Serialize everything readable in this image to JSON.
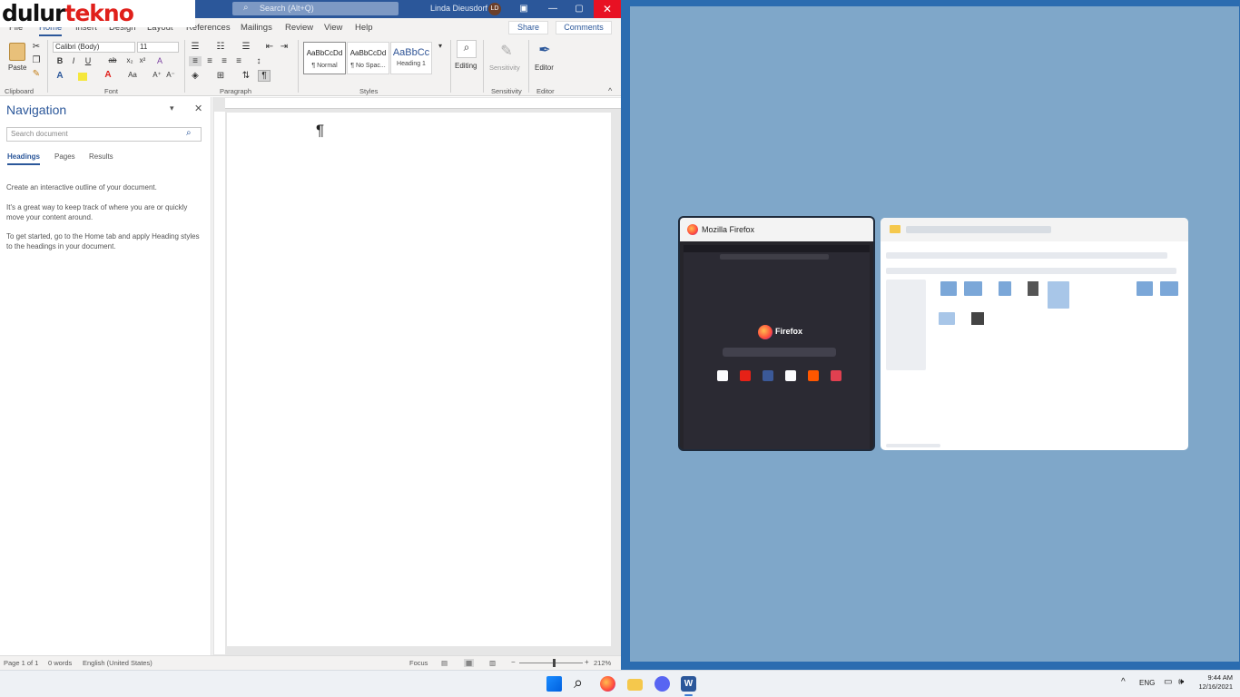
{
  "watermark": {
    "part1": "dulur",
    "part2": "tekno"
  },
  "word": {
    "search_placeholder": "Search (Alt+Q)",
    "user_name": "Linda Dieusdorf",
    "user_initials": "LD",
    "tabs": [
      "File",
      "Home",
      "Insert",
      "Design",
      "Layout",
      "References",
      "Mailings",
      "Review",
      "View",
      "Help"
    ],
    "share": "Share",
    "comments": "Comments",
    "ribbon": {
      "paste": "Paste",
      "font_name": "Calibri (Body)",
      "font_size": "11",
      "groups": [
        "Clipboard",
        "Font",
        "Paragraph",
        "Styles",
        "Sensitivity",
        "Editor"
      ],
      "styles": [
        {
          "preview": "AaBbCcDd",
          "name": "¶ Normal"
        },
        {
          "preview": "AaBbCcDd",
          "name": "¶ No Spac..."
        },
        {
          "preview": "AaBbCc",
          "name": "Heading 1"
        }
      ],
      "editing": "Editing",
      "sensitivity": "Sensitivity",
      "editor": "Editor"
    },
    "nav": {
      "title": "Navigation",
      "search_placeholder": "Search document",
      "tabs": [
        "Headings",
        "Pages",
        "Results"
      ],
      "text1": "Create an interactive outline of your document.",
      "text2": "It's a great way to keep track of where you are or quickly move your content around.",
      "text3": "To get started, go to the Home tab and apply Heading styles to the headings in your document."
    },
    "pilcrow": "¶",
    "status": {
      "page": "Page 1 of 1",
      "words": "0 words",
      "language": "English (United States)",
      "focus": "Focus",
      "zoom": "212%"
    }
  },
  "snap": {
    "firefox_title": "Mozilla Firefox",
    "firefox_brand": "Firefox"
  },
  "taskbar": {
    "lang": "ENG",
    "time": "9:44 AM",
    "date": "12/16/2021"
  },
  "colors": {
    "word_blue": "#2b579a",
    "close_red": "#e81123",
    "desktop": "#2b6cb0"
  }
}
